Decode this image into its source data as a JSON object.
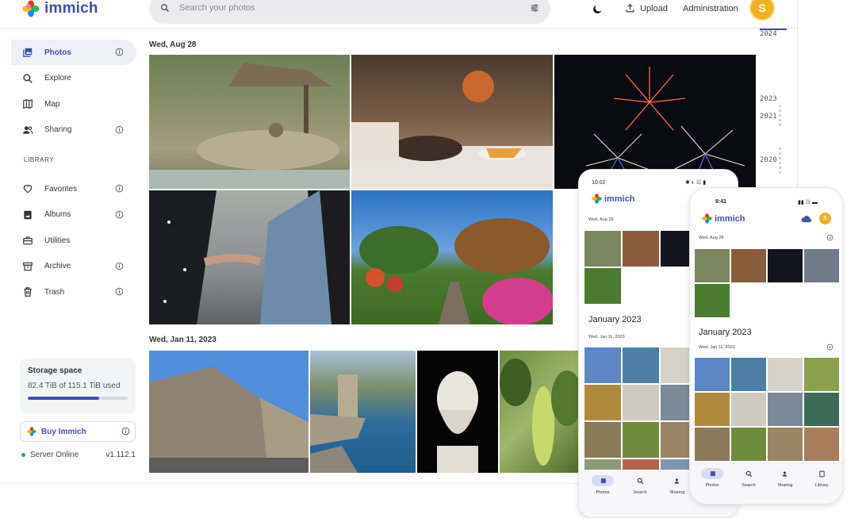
{
  "app": {
    "name": "immich"
  },
  "header": {
    "search_placeholder": "Search your photos",
    "upload_label": "Upload",
    "admin_label": "Administration",
    "avatar_initial": "S",
    "avatar_color": "#f2b01e",
    "accent_color": "#4250af"
  },
  "sidebar": {
    "items": [
      {
        "label": "Photos",
        "icon": "photos-icon",
        "info": true,
        "active": true
      },
      {
        "label": "Explore",
        "icon": "search-icon",
        "info": false
      },
      {
        "label": "Map",
        "icon": "map-icon",
        "info": false
      },
      {
        "label": "Sharing",
        "icon": "sharing-icon",
        "info": true
      }
    ],
    "library_label": "LIBRARY",
    "library_items": [
      {
        "label": "Favorites",
        "icon": "heart-icon",
        "info": true
      },
      {
        "label": "Albums",
        "icon": "album-icon",
        "info": true
      },
      {
        "label": "Utilities",
        "icon": "toolbox-icon",
        "info": false
      },
      {
        "label": "Archive",
        "icon": "archive-icon",
        "info": true
      },
      {
        "label": "Trash",
        "icon": "trash-icon",
        "info": true
      }
    ],
    "storage": {
      "title": "Storage space",
      "used_text": "82.4 TiB of 115.1 TiB used",
      "fraction": 0.716
    },
    "buy_label": "Buy Immich",
    "server_status": "Server Online",
    "version": "v1.112.1"
  },
  "timeline": {
    "groups": [
      {
        "date": "Wed, Aug 28"
      },
      {
        "date": "Wed, Jan 11, 2023"
      }
    ],
    "years": [
      "2024",
      "2023",
      "2021",
      "2020"
    ]
  },
  "phones": {
    "android": {
      "status_time": "10:02",
      "logo": "immich",
      "date1": "Wed, Aug 28",
      "month": "January 2023",
      "date2": "Wed, Jan 11, 2023",
      "tabs": [
        "Photos",
        "Search",
        "Sharing"
      ]
    },
    "ios": {
      "status_time": "9:41",
      "logo": "immich",
      "date1": "Wed, Aug 28",
      "month": "January 2023",
      "date2": "Wed, Jan 11, 2023",
      "tabs": [
        "Photos",
        "Search",
        "Sharing",
        "Library"
      ]
    }
  }
}
